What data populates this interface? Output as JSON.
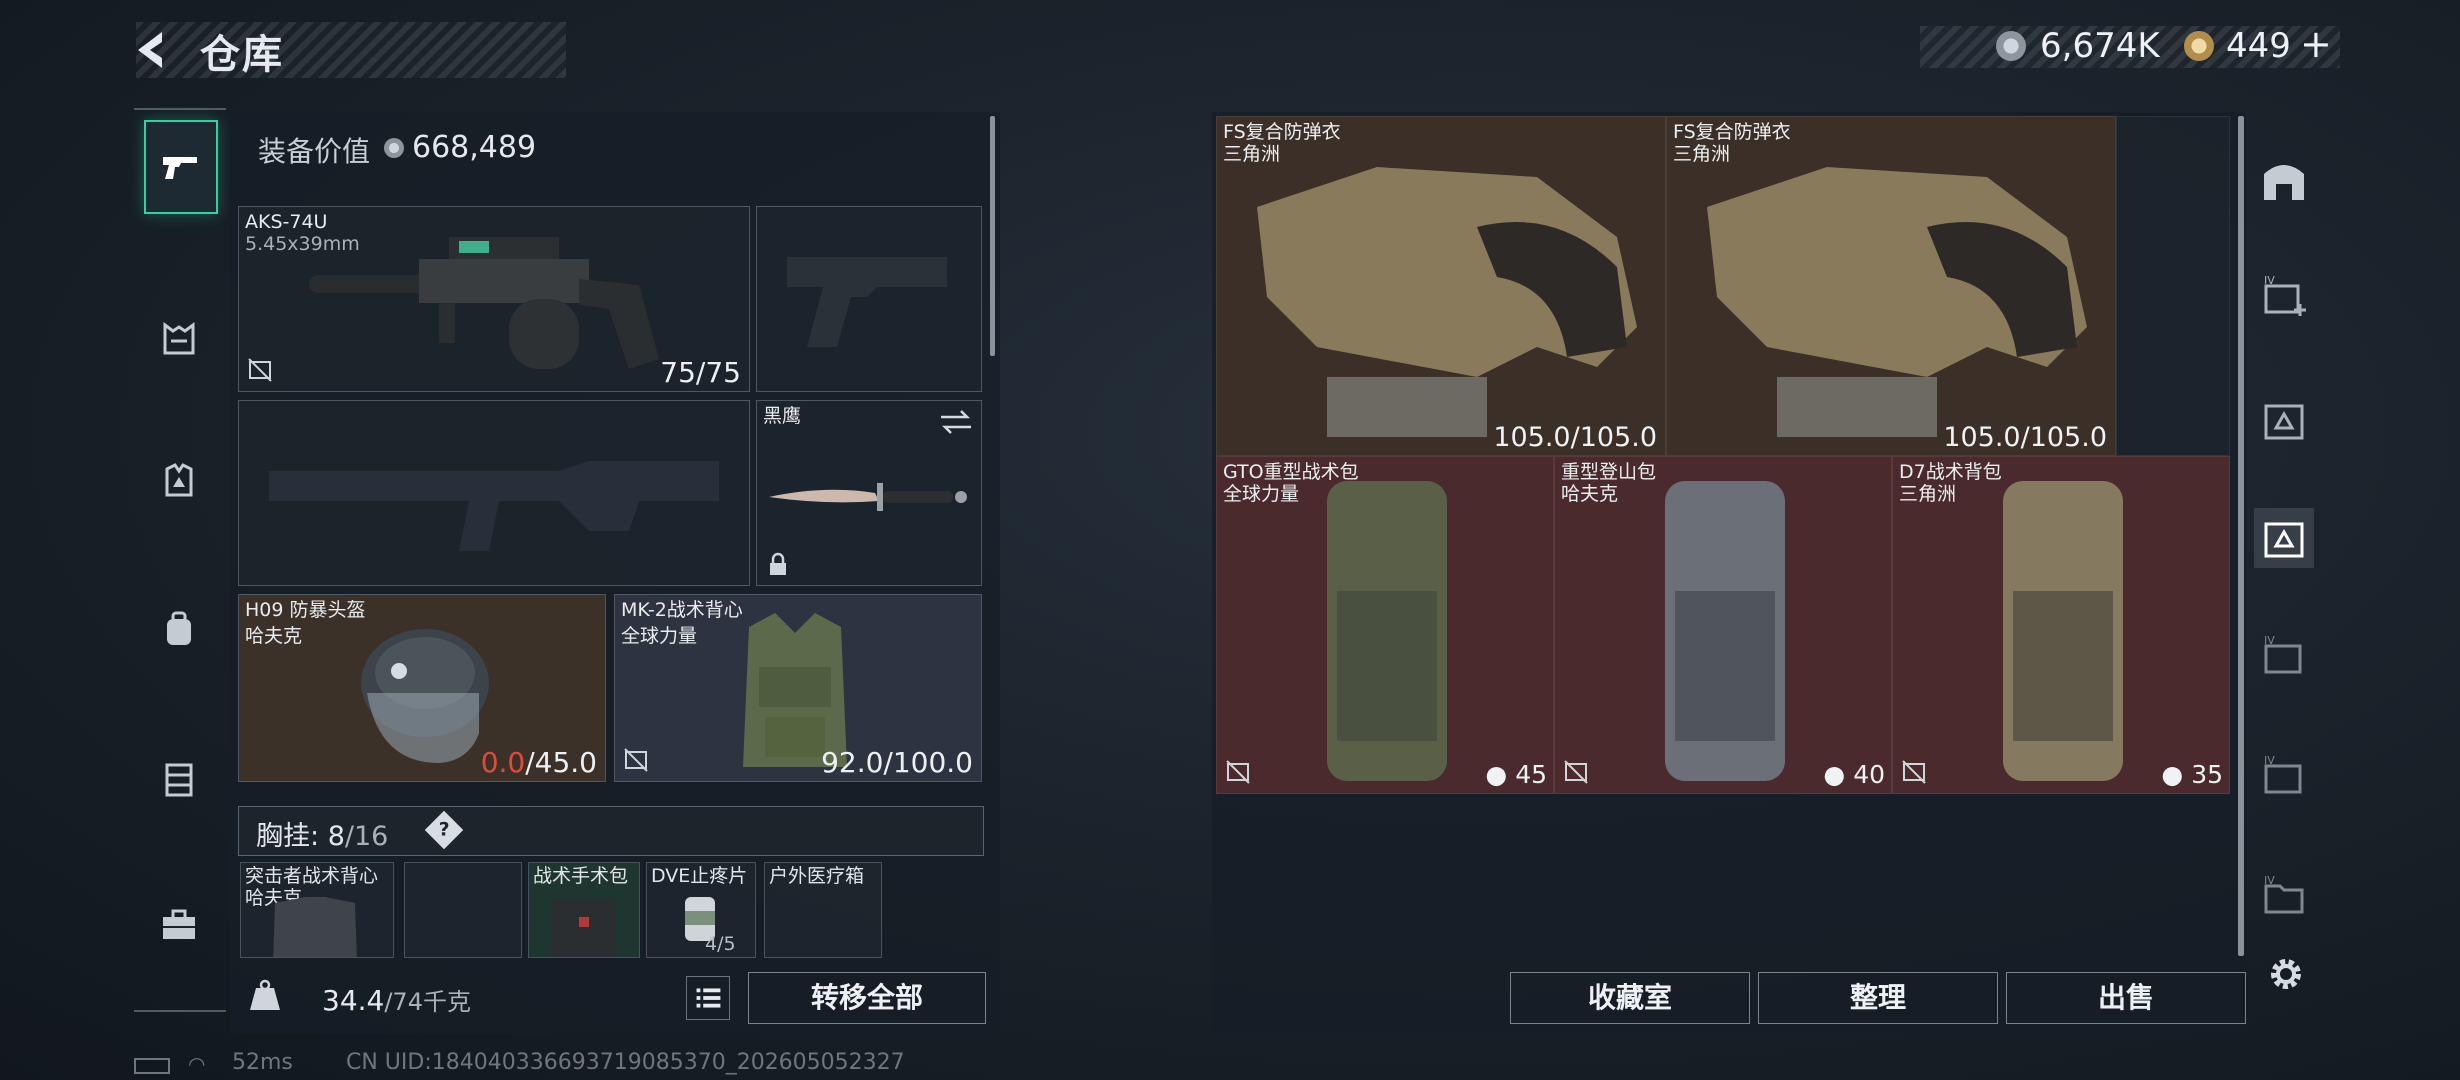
{
  "header": {
    "title": "仓库",
    "currency_primary": "6,674K",
    "currency_secondary": "449",
    "currency_plus": "+"
  },
  "equipment": {
    "value_label": "装备价值",
    "value": "668,489",
    "primary_weapon": {
      "name": "AKS-74U",
      "ammo": "5.45x39mm",
      "durability": "75/75"
    },
    "melee": {
      "name": "黑鹰"
    },
    "helmet": {
      "name": "H09 防暴头盔",
      "brand": "哈夫克",
      "durability_current": "0.0",
      "durability_max": "/45.0"
    },
    "armor": {
      "name": "MK-2战术背心",
      "brand": "全球力量",
      "durability": "92.0/100.0"
    }
  },
  "chest_rig": {
    "label": "胸挂:",
    "capacity_used": "8",
    "capacity_total": "/16",
    "help": "?",
    "items": [
      {
        "name": "突击者战术背心",
        "brand": "哈夫克"
      },
      {
        "name": "战术手术包"
      },
      {
        "name": "DVE止疼片",
        "count": "4/5"
      },
      {
        "name": "户外医疗箱"
      }
    ]
  },
  "footer_left": {
    "weight": "34.4",
    "weight_max": "/74千克",
    "transfer_all": "转移全部"
  },
  "storage": {
    "items": [
      {
        "name": "FS复合防弹衣",
        "brand": "三角洲",
        "durability": "105.0/105.0"
      },
      {
        "name": "FS复合防弹衣",
        "brand": "三角洲",
        "durability": "105.0/105.0"
      },
      {
        "name": "GTO重型战术包",
        "brand": "全球力量",
        "capacity": "45"
      },
      {
        "name": "重型登山包",
        "brand": "哈夫克",
        "capacity": "40"
      },
      {
        "name": "D7战术背包",
        "brand": "三角洲",
        "capacity": "35"
      }
    ]
  },
  "footer_right": {
    "collection": "收藏室",
    "organize": "整理",
    "sell": "出售"
  },
  "status_bar": {
    "ping": "52ms",
    "uid": "CN UID:184040336693719085370_202605052327"
  },
  "colors": {
    "accent": "#2fd3a0",
    "durability_broken": "#e04a3a",
    "armor_cell": "#3b2f28",
    "backpack_cell": "#4a2a2c"
  }
}
